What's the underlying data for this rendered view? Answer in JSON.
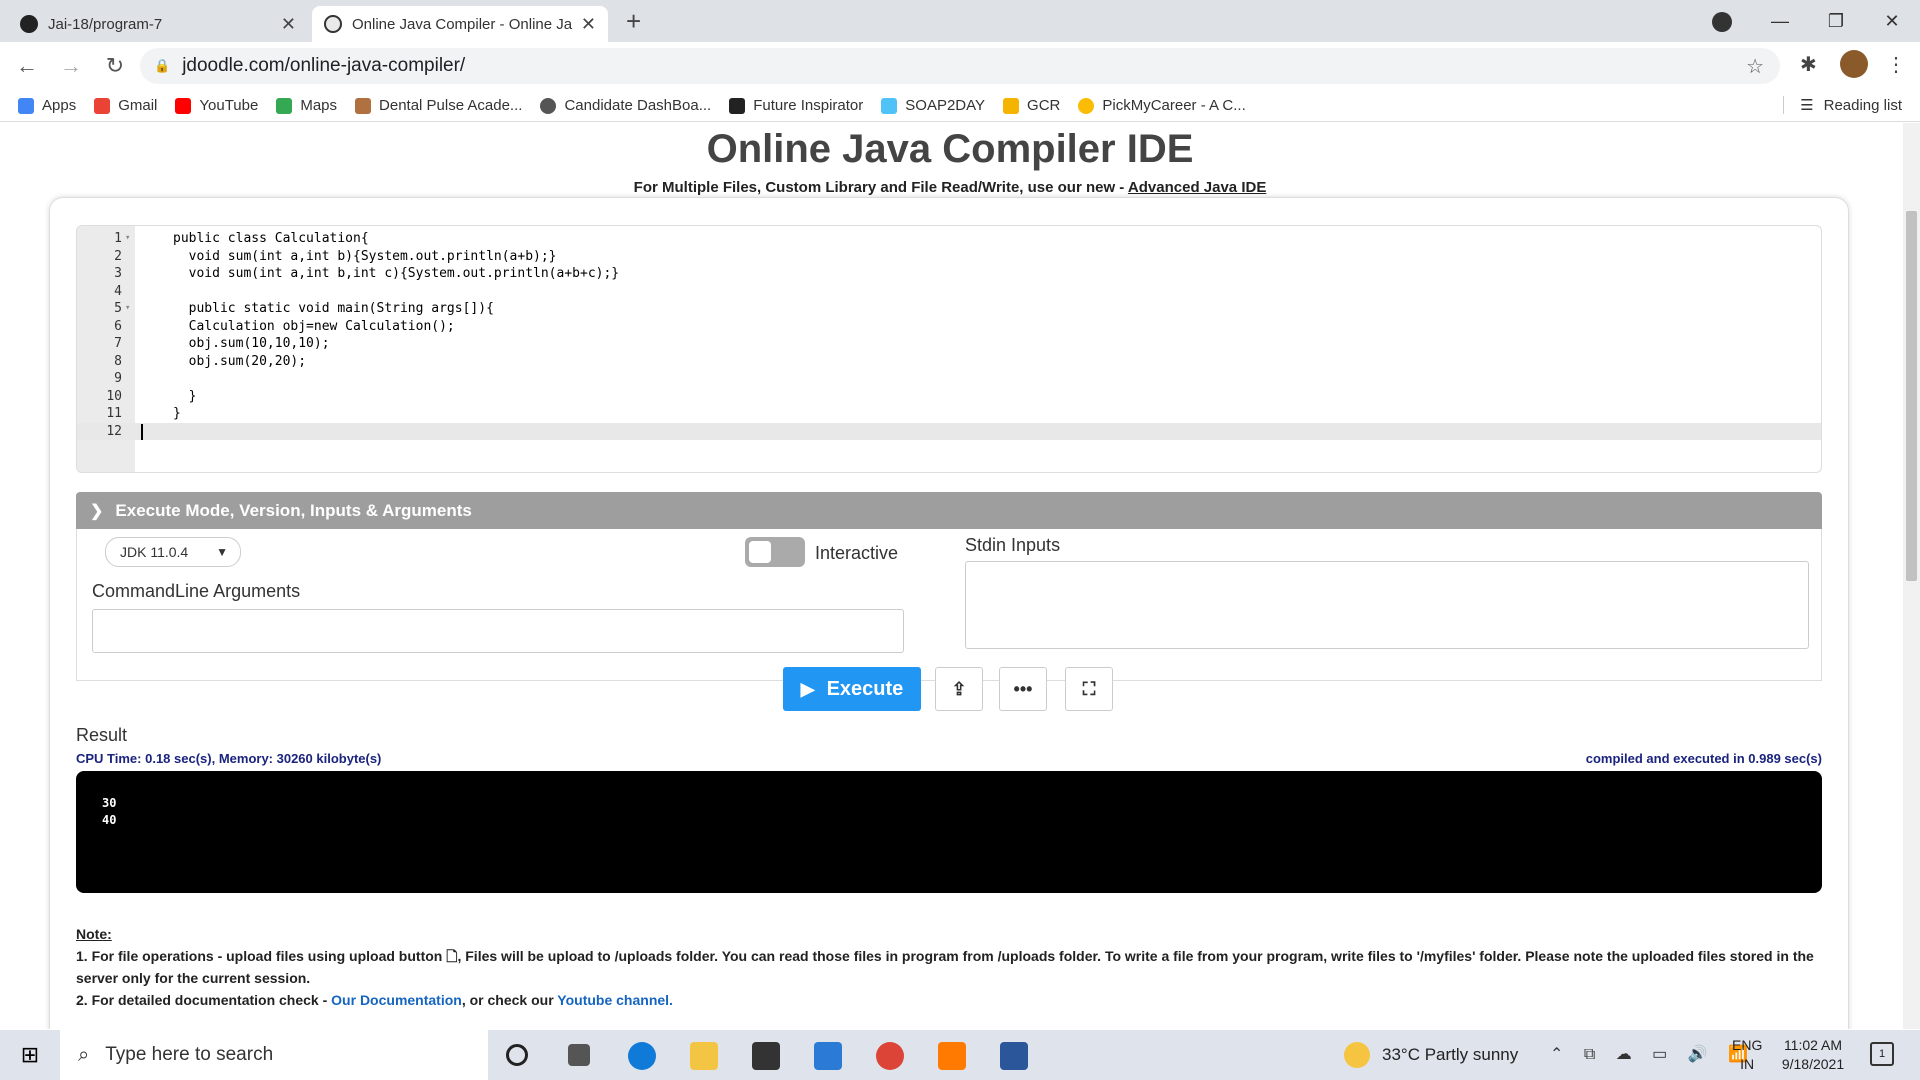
{
  "browser": {
    "tabs": [
      {
        "label": "Jai-18/program-7",
        "active": false
      },
      {
        "label": "Online Java Compiler - Online Ja",
        "active": true
      }
    ],
    "new_tab": "+",
    "window_controls": {
      "minimize": "—",
      "maximize": "❐",
      "close": "✕"
    },
    "url": "jdoodle.com/online-java-compiler/",
    "bookmarks": [
      {
        "label": "Apps",
        "color": "#4285f4"
      },
      {
        "label": "Gmail",
        "color": "#ea4335"
      },
      {
        "label": "YouTube",
        "color": "#ff0000"
      },
      {
        "label": "Maps",
        "color": "#34a853"
      },
      {
        "label": "Dental Pulse Acade...",
        "color": "#b07040"
      },
      {
        "label": "Candidate DashBoa...",
        "color": "#555555"
      },
      {
        "label": "Future Inspirator",
        "color": "#222222"
      },
      {
        "label": "SOAP2DAY",
        "color": "#4fc3f7"
      },
      {
        "label": "GCR",
        "color": "#f4b400"
      },
      {
        "label": "PickMyCareer - A C...",
        "color": "#fbbc05"
      }
    ],
    "reading_list": "Reading list"
  },
  "page": {
    "title": "Online Java Compiler IDE",
    "subtitle_prefix": "For Multiple Files, Custom Library and File Read/Write, use our new - ",
    "subtitle_link": "Advanced Java IDE"
  },
  "editor": {
    "lines": [
      {
        "n": "1",
        "fold": true,
        "code": "public class Calculation{"
      },
      {
        "n": "2",
        "fold": false,
        "code": "  void sum(int a,int b){System.out.println(a+b);}"
      },
      {
        "n": "3",
        "fold": false,
        "code": "  void sum(int a,int b,int c){System.out.println(a+b+c);}"
      },
      {
        "n": "4",
        "fold": false,
        "code": ""
      },
      {
        "n": "5",
        "fold": true,
        "code": "  public static void main(String args[]){"
      },
      {
        "n": "6",
        "fold": false,
        "code": "  Calculation obj=new Calculation();"
      },
      {
        "n": "7",
        "fold": false,
        "code": "  obj.sum(10,10,10);"
      },
      {
        "n": "8",
        "fold": false,
        "code": "  obj.sum(20,20);"
      },
      {
        "n": "9",
        "fold": false,
        "code": ""
      },
      {
        "n": "10",
        "fold": false,
        "code": "  }"
      },
      {
        "n": "11",
        "fold": false,
        "code": "}"
      },
      {
        "n": "12",
        "fold": false,
        "code": ""
      }
    ]
  },
  "execute_panel": {
    "header": "Execute Mode, Version, Inputs & Arguments",
    "jdk_version": "JDK 11.0.4",
    "interactive_label": "Interactive",
    "cmdline_label": "CommandLine Arguments",
    "stdin_label": "Stdin Inputs"
  },
  "buttons": {
    "execute": "Execute",
    "upload_icon": "upload-file-icon",
    "more_icon": "more-icon",
    "fullscreen_icon": "fullscreen-icon"
  },
  "result": {
    "label": "Result",
    "cpu": "CPU Time: 0.18 sec(s), Memory: 30260 kilobyte(s)",
    "compiled": "compiled and executed in 0.989 sec(s)",
    "output": "30\n40"
  },
  "note": {
    "heading": "Note:",
    "line1": "1. For file operations - upload files using upload button 🗋, Files will be upload to /uploads folder. You can read those files in program from /uploads folder. To write a file from your program, write files to '/myfiles' folder. Please note the uploaded files stored in the server only for the current session.",
    "line2_prefix": "2. For detailed documentation check - ",
    "doc_link": "Our Documentation",
    "line2_mid": ", or check our ",
    "yt_link": "Youtube channel."
  },
  "taskbar": {
    "search_placeholder": "Type here to search",
    "weather": "33°C  Partly sunny",
    "lang1": "ENG",
    "lang2": "IN",
    "time": "11:02 AM",
    "date": "9/18/2021",
    "notif_count": "1"
  },
  "colors": {
    "accent": "#2196f3",
    "exec_header": "#9e9e9e",
    "info_text": "#1a237e",
    "link": "#1565c0"
  }
}
